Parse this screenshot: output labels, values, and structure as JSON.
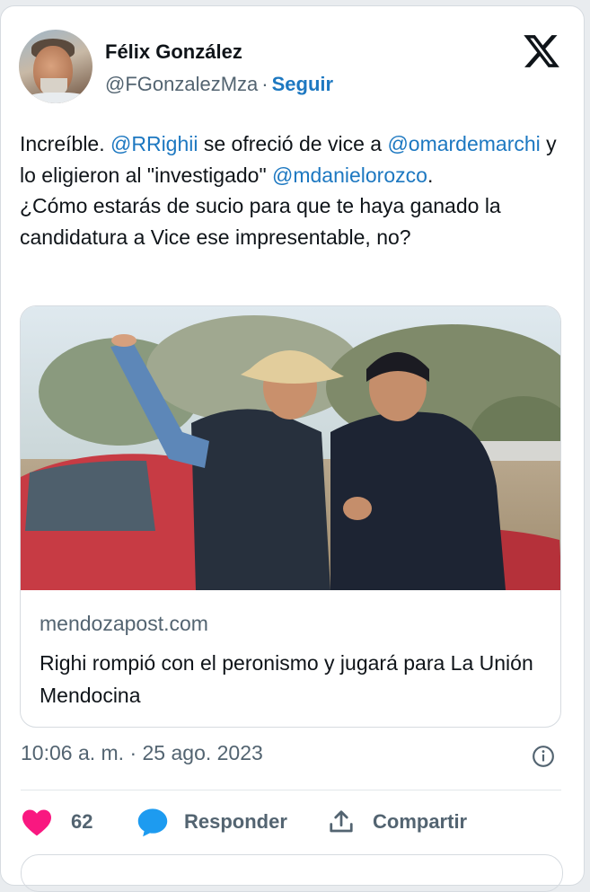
{
  "author": {
    "name": "Félix González",
    "handle": "@FGonzalezMza",
    "separator": "·",
    "follow_label": "Seguir"
  },
  "platform_logo": "x-logo",
  "tweet": {
    "segments": [
      {
        "t": "Increíble.  "
      },
      {
        "t": "@RRighii",
        "mention": true
      },
      {
        "t": " se  ofreció de vice a "
      },
      {
        "t": "@omardemarchi",
        "mention": true
      },
      {
        "t": "  y lo eligieron al  \"investigado\" "
      },
      {
        "t": "@mdanielorozco",
        "mention": true
      },
      {
        "t": ".\n¿Cómo estarás de sucio para que te haya ganado la candidatura a Vice ese impresentable, no?"
      }
    ]
  },
  "link_card": {
    "image_icon": "article-photo",
    "domain": "mendozapost.com",
    "headline": "Righi rompió con el peronismo y jugará para La Unión Mendocina"
  },
  "timestamp": "10:06 a. m. · 25 ago. 2023",
  "actions": {
    "like_count": "62",
    "reply_label": "Responder",
    "share_label": "Compartir"
  },
  "colors": {
    "link": "#1d78c1",
    "like": "#f91880",
    "reply": "#1d9bf0",
    "muted": "#536471"
  }
}
